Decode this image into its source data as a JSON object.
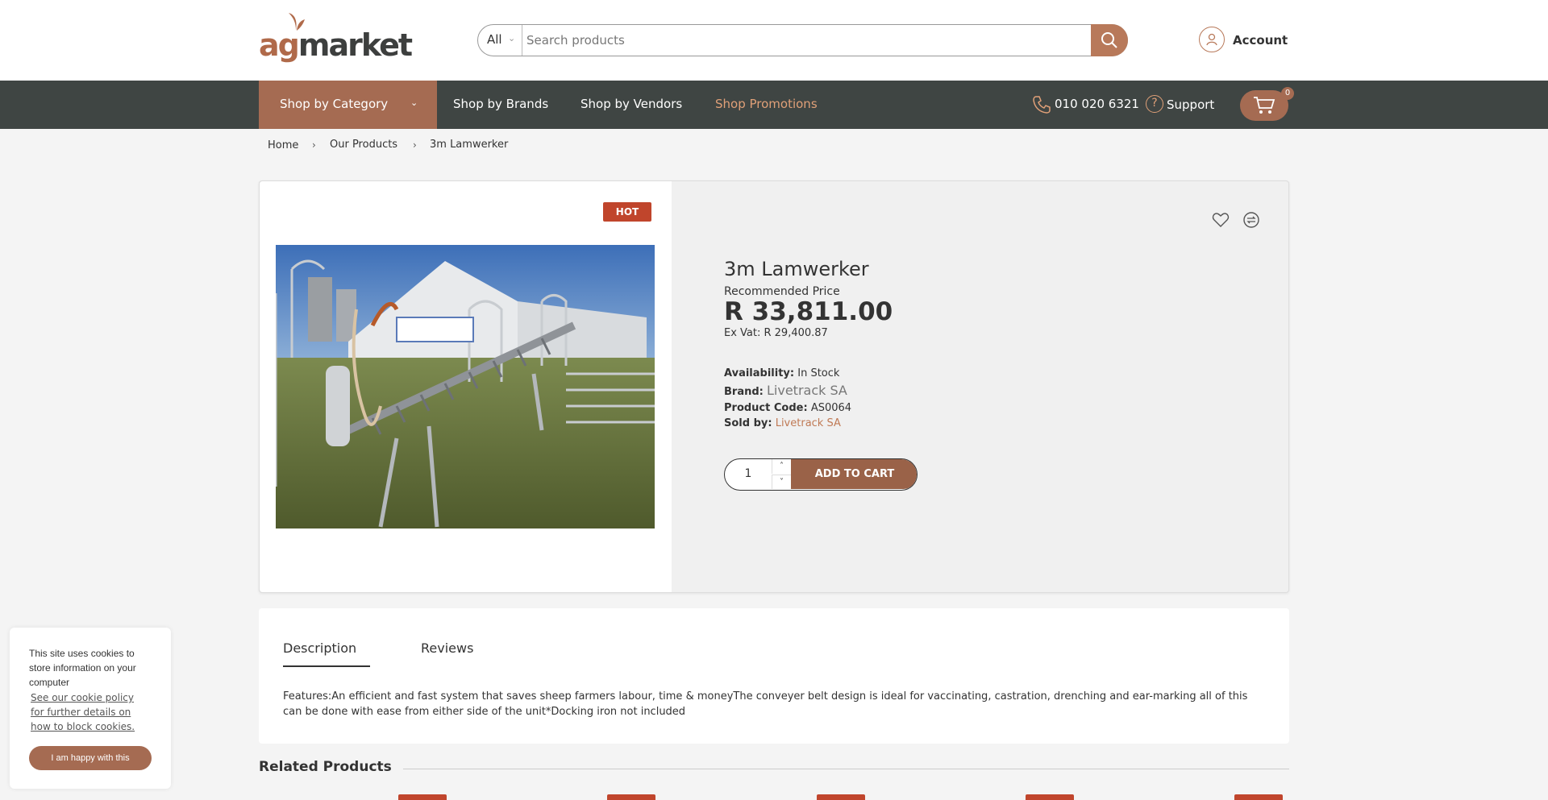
{
  "header": {
    "logo_ag": "ag",
    "logo_market": "market",
    "search": {
      "category": "All",
      "placeholder": "Search products",
      "value": ""
    },
    "account_label": "Account"
  },
  "nav": {
    "category_label": "Shop by Category",
    "links": [
      "Shop by Brands",
      "Shop by Vendors",
      "Shop Promotions"
    ],
    "phone": "010 020 6321",
    "support": "Support",
    "cart_count": "0"
  },
  "breadcrumb": [
    "Home",
    "Our Products",
    "3m Lamwerker"
  ],
  "product": {
    "badge": "HOT",
    "title": "3m Lamwerker",
    "recommended_label": "Recommended Price",
    "price": "R 33,811.00",
    "ex_vat": "Ex Vat: R 29,400.87",
    "availability_label": "Availability:",
    "availability_value": "In Stock",
    "brand_label": "Brand:",
    "brand_value": "Livetrack SA",
    "code_label": "Product Code:",
    "code_value": "AS0064",
    "sold_label": "Sold by:",
    "sold_value": "Livetrack SA",
    "quantity": "1",
    "add_to_cart": "ADD TO CART"
  },
  "tabs": [
    "Description",
    "Reviews"
  ],
  "description": "Features:An efficient and fast system that saves sheep farmers labour, time & moneyThe conveyer belt design is ideal for vaccinating, castration, drenching and ear-marking all of this can be done with ease from either side of the unit*Docking iron not included",
  "related_title": "Related Products",
  "cookie": {
    "text": "This site uses cookies to store information on your computer",
    "link": "See our cookie policy for further details on how to block cookies.",
    "button": "I am happy with this"
  },
  "colors": {
    "brand": "#a56b52",
    "nav_bg": "#3f4543",
    "badge": "#c0452c",
    "promo": "#e0a078"
  }
}
